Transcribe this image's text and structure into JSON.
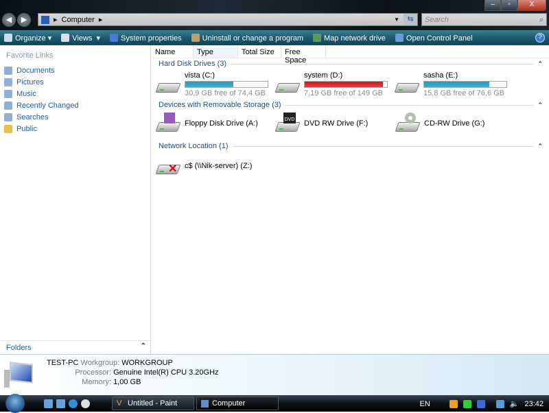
{
  "window": {
    "breadcrumb": "Computer",
    "search_placeholder": "Search"
  },
  "toolbar": {
    "organize": "Organize",
    "views": "Views",
    "system_properties": "System properties",
    "uninstall": "Uninstall or change a program",
    "map_drive": "Map network drive",
    "control_panel": "Open Control Panel",
    "help": "?"
  },
  "sidebar": {
    "heading": "Favorite Links",
    "items": [
      {
        "label": "Documents"
      },
      {
        "label": "Pictures"
      },
      {
        "label": "Music"
      },
      {
        "label": "Recently Changed"
      },
      {
        "label": "Searches"
      },
      {
        "label": "Public"
      }
    ],
    "folders": "Folders"
  },
  "columns": [
    "Name",
    "Type",
    "Total Size",
    "Free Space"
  ],
  "groups": {
    "hdd": {
      "title": "Hard Disk Drives (3)",
      "items": [
        {
          "name": "vista (C:)",
          "info": "30,9 GB free of 74,4 GB",
          "used_fraction": 0.58,
          "color": "#1e9ac4"
        },
        {
          "name": "system (D:)",
          "info": "7,19 GB free of 149 GB",
          "used_fraction": 0.95,
          "color": "#d4141c"
        },
        {
          "name": "sasha (E:)",
          "info": "15,8 GB free of 76,6 GB",
          "used_fraction": 0.79,
          "color": "#1e9ac4"
        }
      ]
    },
    "removable": {
      "title": "Devices with Removable Storage (3)",
      "items": [
        {
          "name": "Floppy Disk Drive (A:)"
        },
        {
          "name": "DVD RW Drive (F:)",
          "badge": "DVD"
        },
        {
          "name": "CD-RW Drive (G:)"
        }
      ]
    },
    "network": {
      "title": "Network Location (1)",
      "items": [
        {
          "name": "c$ (\\\\Nik-server) (Z:)"
        }
      ]
    }
  },
  "details": {
    "computer": "TEST-PC",
    "workgroup_label": "Workgroup:",
    "workgroup": "WORKGROUP",
    "processor_label": "Processor:",
    "processor": "Genuine Intel(R) CPU 3.20GHz",
    "memory_label": "Memory:",
    "memory": "1,00 GB"
  },
  "taskbar": {
    "tasks": [
      "Untitled - Paint",
      "Computer"
    ],
    "lang": "EN",
    "clock": "23:42"
  }
}
